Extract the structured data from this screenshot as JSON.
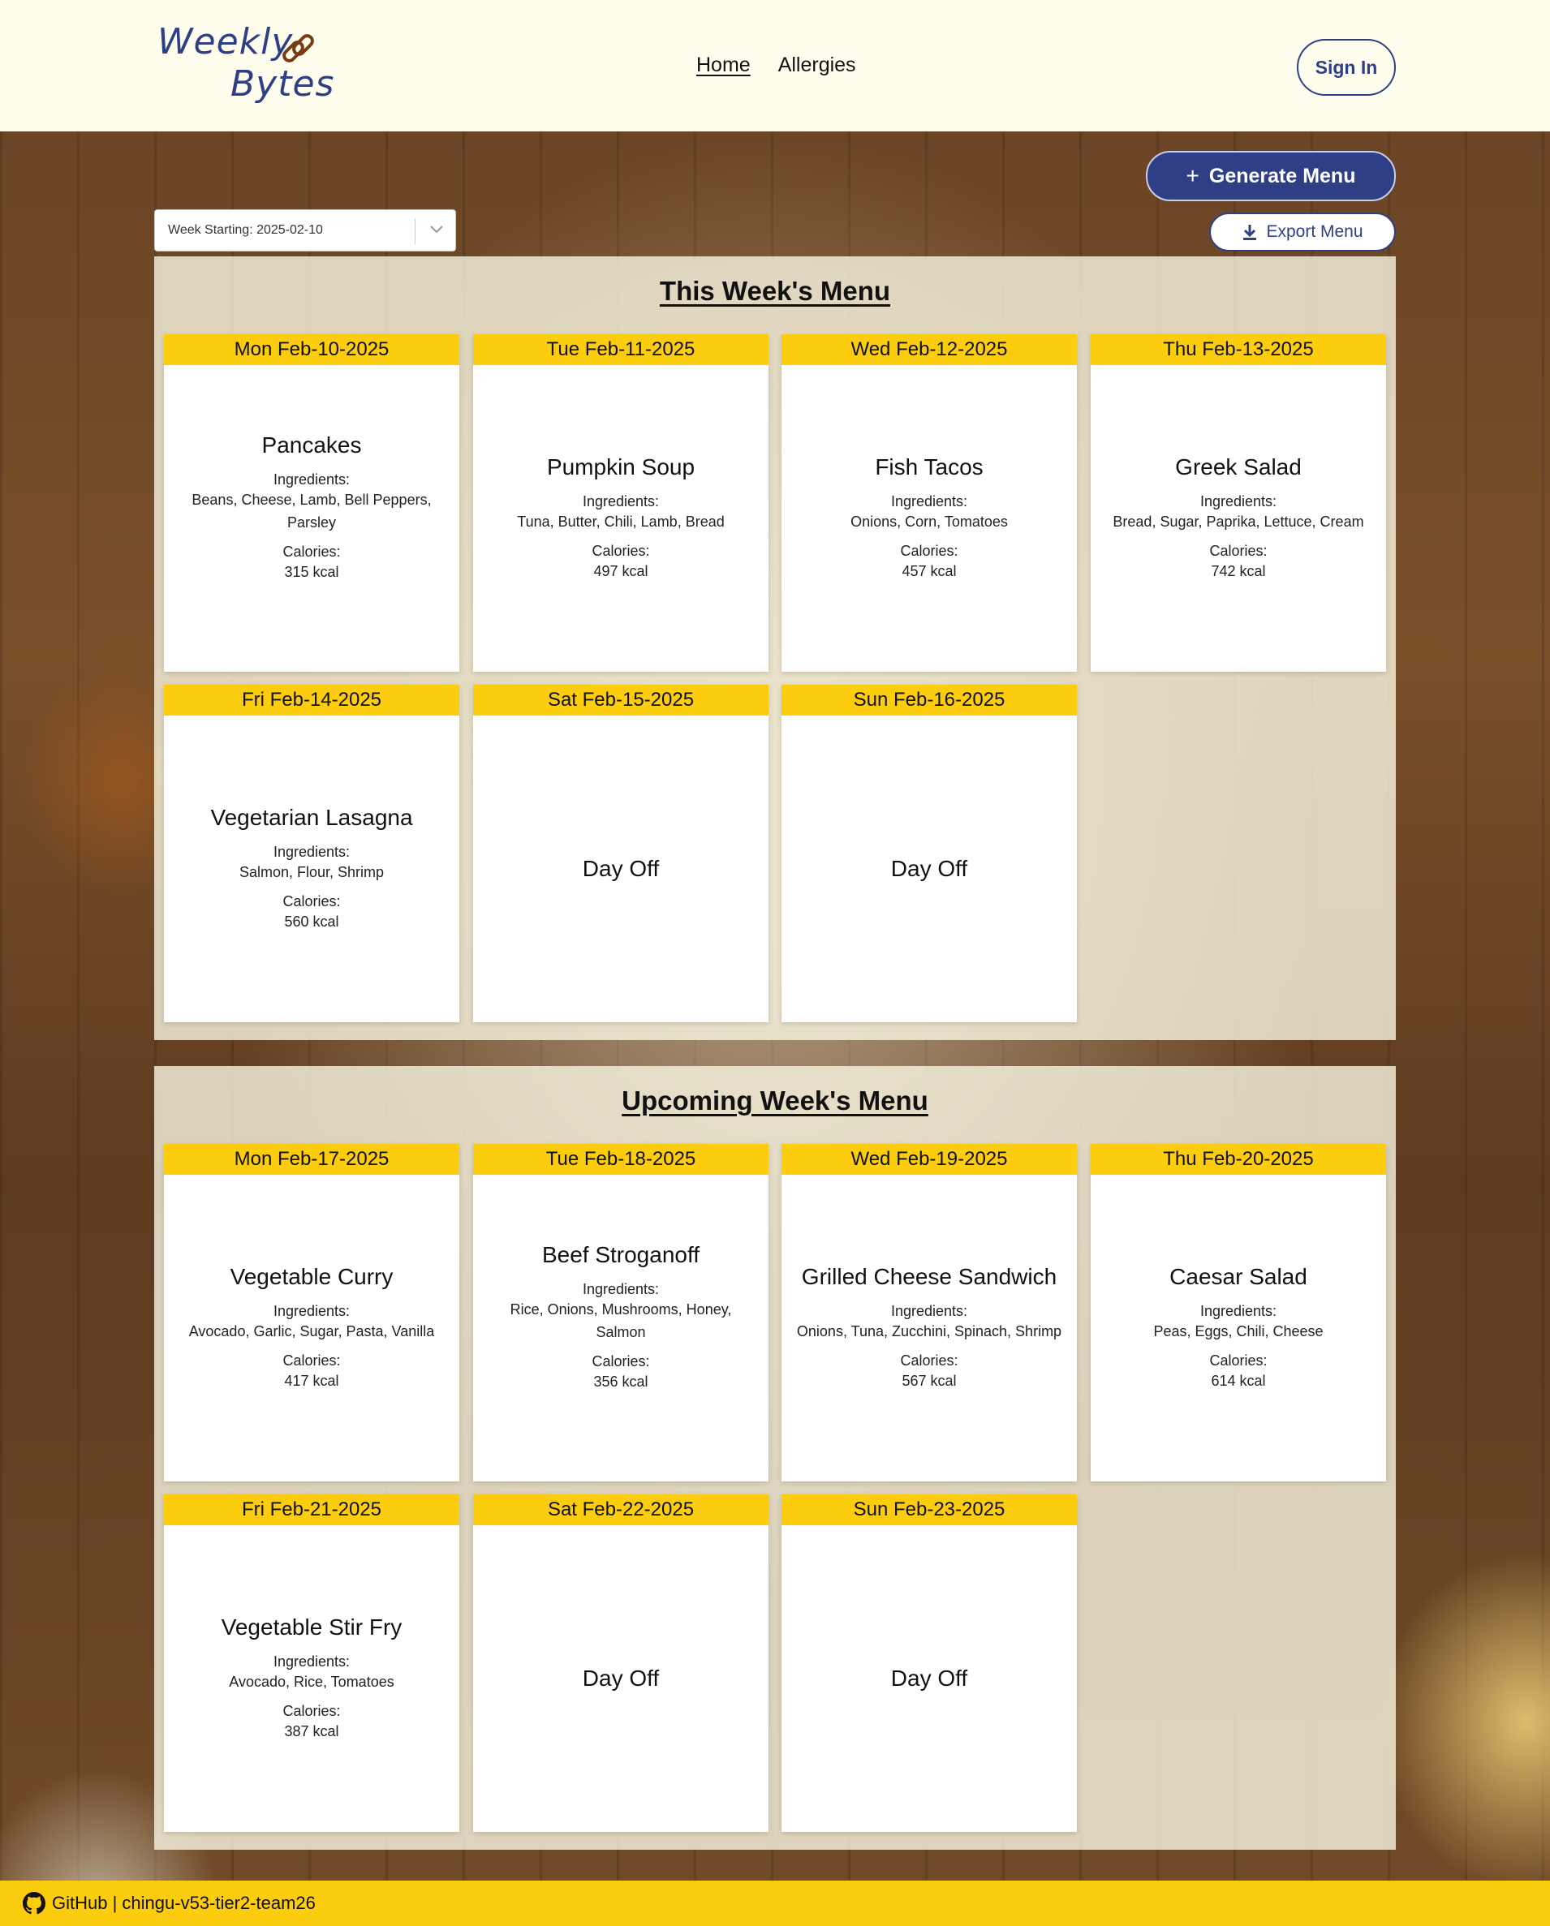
{
  "header": {
    "logo_line1": "Weekly",
    "logo_line2": "Bytes",
    "nav": [
      {
        "label": "Home"
      },
      {
        "label": "Allergies"
      }
    ],
    "sign_in": "Sign In"
  },
  "controls": {
    "generate_menu": "Generate Menu",
    "export_menu": "Export Menu",
    "week_select_value": "Week Starting: 2025-02-10"
  },
  "this_week": {
    "title": "This Week's Menu",
    "days": [
      {
        "date": "Mon Feb-10-2025",
        "dish": "Pancakes",
        "ingredients_label": "Ingredients:",
        "ingredients": "Beans, Cheese, Lamb, Bell Peppers, Parsley",
        "calories_label": "Calories:",
        "calories": "315 kcal"
      },
      {
        "date": "Tue Feb-11-2025",
        "dish": "Pumpkin Soup",
        "ingredients_label": "Ingredients:",
        "ingredients": "Tuna, Butter, Chili, Lamb, Bread",
        "calories_label": "Calories:",
        "calories": "497 kcal"
      },
      {
        "date": "Wed Feb-12-2025",
        "dish": "Fish Tacos",
        "ingredients_label": "Ingredients:",
        "ingredients": "Onions, Corn, Tomatoes",
        "calories_label": "Calories:",
        "calories": "457 kcal"
      },
      {
        "date": "Thu Feb-13-2025",
        "dish": "Greek Salad",
        "ingredients_label": "Ingredients:",
        "ingredients": "Bread, Sugar, Paprika, Lettuce, Cream",
        "calories_label": "Calories:",
        "calories": "742 kcal"
      },
      {
        "date": "Fri Feb-14-2025",
        "dish": "Vegetarian Lasagna",
        "ingredients_label": "Ingredients:",
        "ingredients": "Salmon, Flour, Shrimp",
        "calories_label": "Calories:",
        "calories": "560 kcal"
      },
      {
        "date": "Sat Feb-15-2025",
        "day_off": "Day Off"
      },
      {
        "date": "Sun Feb-16-2025",
        "day_off": "Day Off"
      }
    ]
  },
  "upcoming_week": {
    "title": "Upcoming Week's Menu",
    "days": [
      {
        "date": "Mon Feb-17-2025",
        "dish": "Vegetable Curry",
        "ingredients_label": "Ingredients:",
        "ingredients": "Avocado, Garlic, Sugar, Pasta, Vanilla",
        "calories_label": "Calories:",
        "calories": "417 kcal"
      },
      {
        "date": "Tue Feb-18-2025",
        "dish": "Beef Stroganoff",
        "ingredients_label": "Ingredients:",
        "ingredients": "Rice, Onions, Mushrooms, Honey, Salmon",
        "calories_label": "Calories:",
        "calories": "356 kcal"
      },
      {
        "date": "Wed Feb-19-2025",
        "dish": "Grilled Cheese Sandwich",
        "ingredients_label": "Ingredients:",
        "ingredients": "Onions, Tuna, Zucchini, Spinach, Shrimp",
        "calories_label": "Calories:",
        "calories": "567 kcal"
      },
      {
        "date": "Thu Feb-20-2025",
        "dish": "Caesar Salad",
        "ingredients_label": "Ingredients:",
        "ingredients": "Peas, Eggs, Chili, Cheese",
        "calories_label": "Calories:",
        "calories": "614 kcal"
      },
      {
        "date": "Fri Feb-21-2025",
        "dish": "Vegetable Stir Fry",
        "ingredients_label": "Ingredients:",
        "ingredients": "Avocado, Rice, Tomatoes",
        "calories_label": "Calories:",
        "calories": "387 kcal"
      },
      {
        "date": "Sat Feb-22-2025",
        "day_off": "Day Off"
      },
      {
        "date": "Sun Feb-23-2025",
        "day_off": "Day Off"
      }
    ]
  },
  "footer": {
    "text": "GitHub | chingu-v53-tier2-team26"
  },
  "colors": {
    "brand": "#2f3f86",
    "accent_yellow": "#fccc0f",
    "header_bg": "#fffeee"
  },
  "icons": [
    "link-icon",
    "plus-icon",
    "download-icon",
    "chevron-down-icon",
    "github-icon"
  ]
}
